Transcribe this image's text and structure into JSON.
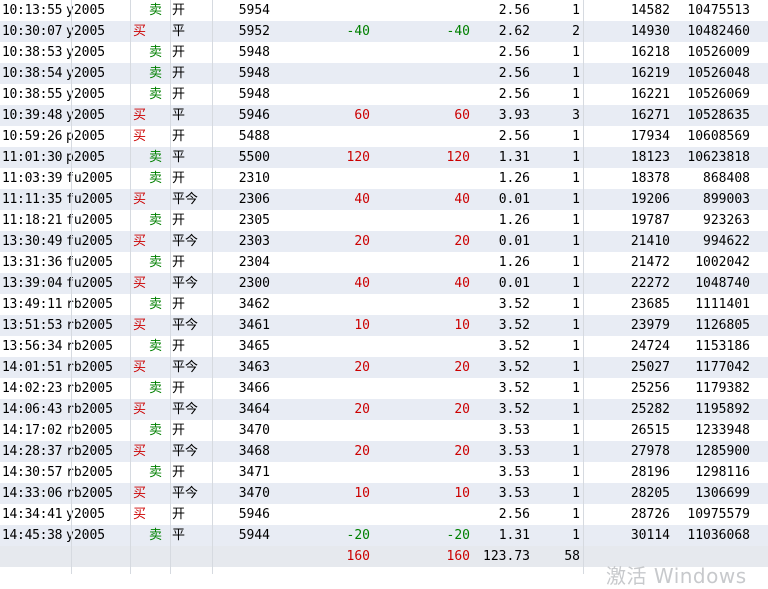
{
  "table": {
    "rows": [
      {
        "time": "10:13:55",
        "code": "y2005",
        "side": "卖",
        "oc": "开",
        "price": "5954",
        "p1": "",
        "p2": "",
        "fee": "2.56",
        "vol": "1",
        "seq": "14582",
        "id": "10475513"
      },
      {
        "time": "10:30:07",
        "code": "y2005",
        "side": "买",
        "oc": "平",
        "price": "5952",
        "p1": "-40",
        "p2": "-40",
        "fee": "2.62",
        "vol": "2",
        "seq": "14930",
        "id": "10482460"
      },
      {
        "time": "10:38:53",
        "code": "y2005",
        "side": "卖",
        "oc": "开",
        "price": "5948",
        "p1": "",
        "p2": "",
        "fee": "2.56",
        "vol": "1",
        "seq": "16218",
        "id": "10526009"
      },
      {
        "time": "10:38:54",
        "code": "y2005",
        "side": "卖",
        "oc": "开",
        "price": "5948",
        "p1": "",
        "p2": "",
        "fee": "2.56",
        "vol": "1",
        "seq": "16219",
        "id": "10526048"
      },
      {
        "time": "10:38:55",
        "code": "y2005",
        "side": "卖",
        "oc": "开",
        "price": "5948",
        "p1": "",
        "p2": "",
        "fee": "2.56",
        "vol": "1",
        "seq": "16221",
        "id": "10526069"
      },
      {
        "time": "10:39:48",
        "code": "y2005",
        "side": "买",
        "oc": "平",
        "price": "5946",
        "p1": "60",
        "p2": "60",
        "fee": "3.93",
        "vol": "3",
        "seq": "16271",
        "id": "10528635"
      },
      {
        "time": "10:59:26",
        "code": "p2005",
        "side": "买",
        "oc": "开",
        "price": "5488",
        "p1": "",
        "p2": "",
        "fee": "2.56",
        "vol": "1",
        "seq": "17934",
        "id": "10608569"
      },
      {
        "time": "11:01:30",
        "code": "p2005",
        "side": "卖",
        "oc": "平",
        "price": "5500",
        "p1": "120",
        "p2": "120",
        "fee": "1.31",
        "vol": "1",
        "seq": "18123",
        "id": "10623818"
      },
      {
        "time": "11:03:39",
        "code": "fu2005",
        "side": "卖",
        "oc": "开",
        "price": "2310",
        "p1": "",
        "p2": "",
        "fee": "1.26",
        "vol": "1",
        "seq": "18378",
        "id": "868408"
      },
      {
        "time": "11:11:35",
        "code": "fu2005",
        "side": "买",
        "oc": "平今",
        "price": "2306",
        "p1": "40",
        "p2": "40",
        "fee": "0.01",
        "vol": "1",
        "seq": "19206",
        "id": "899003"
      },
      {
        "time": "11:18:21",
        "code": "fu2005",
        "side": "卖",
        "oc": "开",
        "price": "2305",
        "p1": "",
        "p2": "",
        "fee": "1.26",
        "vol": "1",
        "seq": "19787",
        "id": "923263"
      },
      {
        "time": "13:30:49",
        "code": "fu2005",
        "side": "买",
        "oc": "平今",
        "price": "2303",
        "p1": "20",
        "p2": "20",
        "fee": "0.01",
        "vol": "1",
        "seq": "21410",
        "id": "994622"
      },
      {
        "time": "13:31:36",
        "code": "fu2005",
        "side": "卖",
        "oc": "开",
        "price": "2304",
        "p1": "",
        "p2": "",
        "fee": "1.26",
        "vol": "1",
        "seq": "21472",
        "id": "1002042"
      },
      {
        "time": "13:39:04",
        "code": "fu2005",
        "side": "买",
        "oc": "平今",
        "price": "2300",
        "p1": "40",
        "p2": "40",
        "fee": "0.01",
        "vol": "1",
        "seq": "22272",
        "id": "1048740"
      },
      {
        "time": "13:49:11",
        "code": "rb2005",
        "side": "卖",
        "oc": "开",
        "price": "3462",
        "p1": "",
        "p2": "",
        "fee": "3.52",
        "vol": "1",
        "seq": "23685",
        "id": "1111401"
      },
      {
        "time": "13:51:53",
        "code": "rb2005",
        "side": "买",
        "oc": "平今",
        "price": "3461",
        "p1": "10",
        "p2": "10",
        "fee": "3.52",
        "vol": "1",
        "seq": "23979",
        "id": "1126805"
      },
      {
        "time": "13:56:34",
        "code": "rb2005",
        "side": "卖",
        "oc": "开",
        "price": "3465",
        "p1": "",
        "p2": "",
        "fee": "3.52",
        "vol": "1",
        "seq": "24724",
        "id": "1153186"
      },
      {
        "time": "14:01:51",
        "code": "rb2005",
        "side": "买",
        "oc": "平今",
        "price": "3463",
        "p1": "20",
        "p2": "20",
        "fee": "3.52",
        "vol": "1",
        "seq": "25027",
        "id": "1177042"
      },
      {
        "time": "14:02:23",
        "code": "rb2005",
        "side": "卖",
        "oc": "开",
        "price": "3466",
        "p1": "",
        "p2": "",
        "fee": "3.52",
        "vol": "1",
        "seq": "25256",
        "id": "1179382"
      },
      {
        "time": "14:06:43",
        "code": "rb2005",
        "side": "买",
        "oc": "平今",
        "price": "3464",
        "p1": "20",
        "p2": "20",
        "fee": "3.52",
        "vol": "1",
        "seq": "25282",
        "id": "1195892"
      },
      {
        "time": "14:17:02",
        "code": "rb2005",
        "side": "卖",
        "oc": "开",
        "price": "3470",
        "p1": "",
        "p2": "",
        "fee": "3.53",
        "vol": "1",
        "seq": "26515",
        "id": "1233948"
      },
      {
        "time": "14:28:37",
        "code": "rb2005",
        "side": "买",
        "oc": "平今",
        "price": "3468",
        "p1": "20",
        "p2": "20",
        "fee": "3.53",
        "vol": "1",
        "seq": "27978",
        "id": "1285900"
      },
      {
        "time": "14:30:57",
        "code": "rb2005",
        "side": "卖",
        "oc": "开",
        "price": "3471",
        "p1": "",
        "p2": "",
        "fee": "3.53",
        "vol": "1",
        "seq": "28196",
        "id": "1298116"
      },
      {
        "time": "14:33:06",
        "code": "rb2005",
        "side": "买",
        "oc": "平今",
        "price": "3470",
        "p1": "10",
        "p2": "10",
        "fee": "3.53",
        "vol": "1",
        "seq": "28205",
        "id": "1306699"
      },
      {
        "time": "14:34:41",
        "code": "y2005",
        "side": "买",
        "oc": "开",
        "price": "5946",
        "p1": "",
        "p2": "",
        "fee": "2.56",
        "vol": "1",
        "seq": "28726",
        "id": "10975579"
      },
      {
        "time": "14:45:38",
        "code": "y2005",
        "side": "卖",
        "oc": "平",
        "price": "5944",
        "p1": "-20",
        "p2": "-20",
        "fee": "1.31",
        "vol": "1",
        "seq": "30114",
        "id": "11036068"
      }
    ],
    "totals": {
      "p1": "160",
      "p2": "160",
      "fee": "123.73",
      "vol": "58"
    }
  },
  "watermark": "激活 Windows",
  "colors": {
    "buy": "#cc0000",
    "sell": "#008000",
    "row_alt": "#e8ecf4",
    "total_row": "#e6e9ee"
  }
}
